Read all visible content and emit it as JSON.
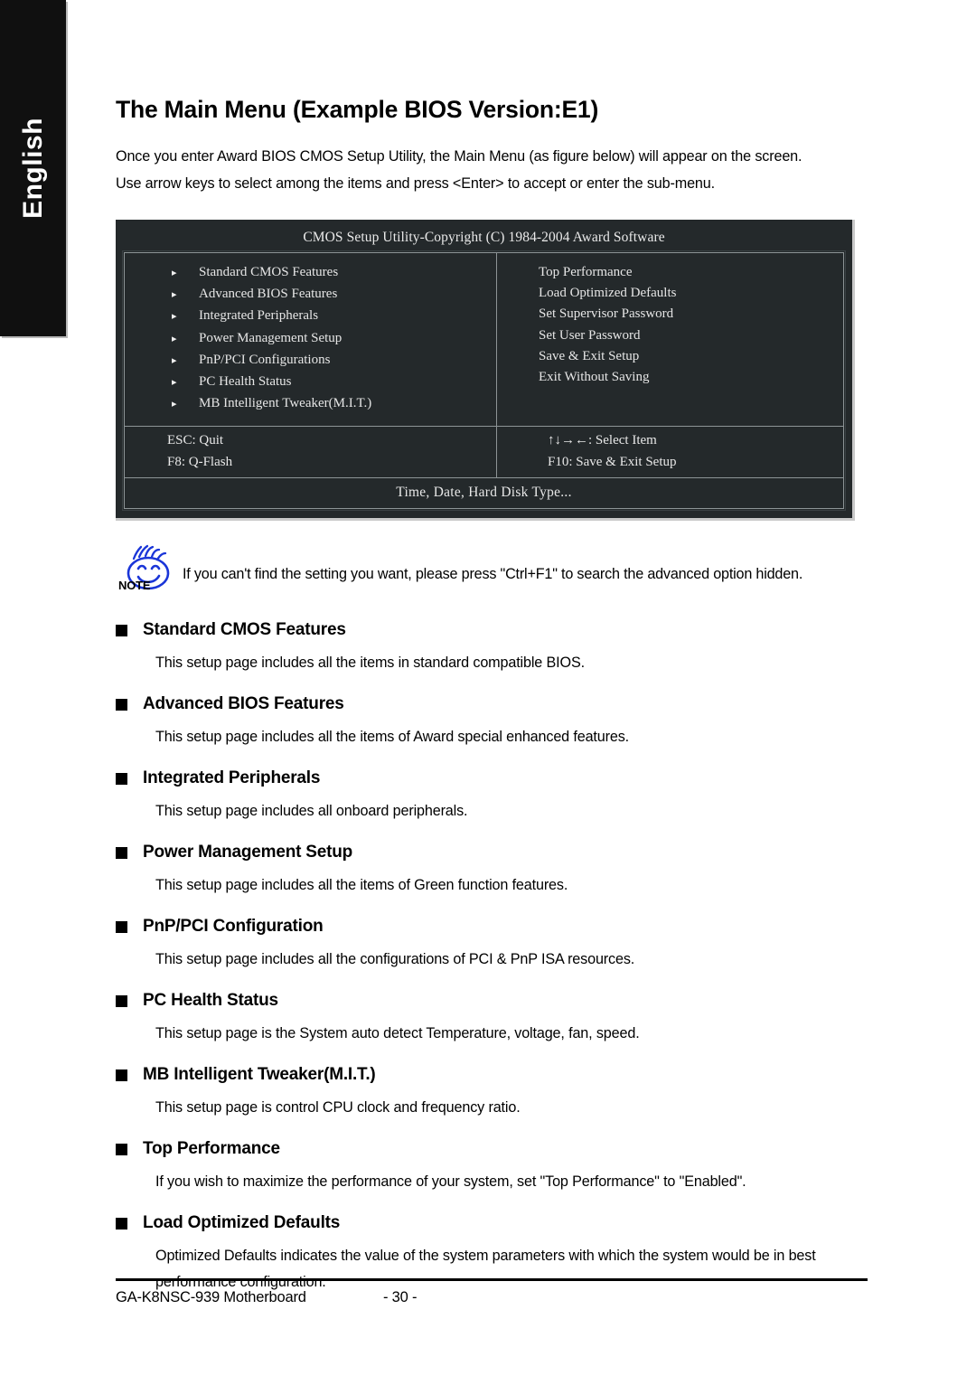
{
  "sidebar": {
    "language_label": "English"
  },
  "header": {
    "title": "The Main Menu (Example BIOS Version:E1)",
    "intro_line1": "Once you enter Award BIOS CMOS Setup Utility, the Main Menu (as figure below) will appear on the screen.",
    "intro_line2": "Use arrow keys to select among the items and press <Enter> to accept or enter the sub-menu."
  },
  "bios": {
    "title": "CMOS Setup Utility-Copyright (C) 1984-2004 Award Software",
    "triangle_glyph": "▸",
    "left_items": [
      "Standard CMOS Features",
      "Advanced BIOS Features",
      "Integrated Peripherals",
      "Power Management Setup",
      "PnP/PCI Configurations",
      "PC Health Status",
      "MB Intelligent Tweaker(M.I.T.)"
    ],
    "right_items": [
      "Top Performance",
      "Load Optimized Defaults",
      "Set Supervisor Password",
      "Set User Password",
      "Save & Exit Setup",
      "Exit Without Saving"
    ],
    "keys_left": [
      "ESC: Quit",
      "F8: Q-Flash"
    ],
    "keys_right": [
      "↑↓→←: Select Item",
      "F10: Save & Exit Setup"
    ],
    "status_line": "Time, Date, Hard Disk Type...",
    "colors": {
      "screen_bg": "#24292b",
      "border": "#8d9496",
      "text": "#e6e6e6"
    }
  },
  "note": {
    "label": "NOTE",
    "text": "If you can't find the setting you want, please press \"Ctrl+F1\" to search the advanced option hidden.",
    "icon_color": "#1a35d8"
  },
  "sections": [
    {
      "heading": "Standard CMOS Features",
      "body": "This setup page includes all the items in standard compatible BIOS."
    },
    {
      "heading": "Advanced BIOS Features",
      "body": "This setup page includes all the items of Award special enhanced features."
    },
    {
      "heading": "Integrated Peripherals",
      "body": "This setup page includes all onboard peripherals."
    },
    {
      "heading": "Power Management Setup",
      "body": "This setup page includes all the items of Green function features."
    },
    {
      "heading": "PnP/PCI Configuration",
      "body": "This setup page includes all the configurations of PCI & PnP ISA resources."
    },
    {
      "heading": "PC Health Status",
      "body": "This setup page is the System auto detect Temperature, voltage, fan, speed."
    },
    {
      "heading": "MB Intelligent Tweaker(M.I.T.)",
      "body": "This setup page is control CPU clock and frequency ratio."
    },
    {
      "heading": "Top Performance",
      "body": "If you wish to maximize the performance of your system, set \"Top Performance\" to \"Enabled\"."
    },
    {
      "heading": "Load Optimized Defaults",
      "body": "Optimized Defaults indicates the value of the system parameters with which the system would be in best performance configuration."
    }
  ],
  "footer": {
    "product": "GA-K8NSC-939 Motherboard",
    "page_number": "- 30 -"
  }
}
